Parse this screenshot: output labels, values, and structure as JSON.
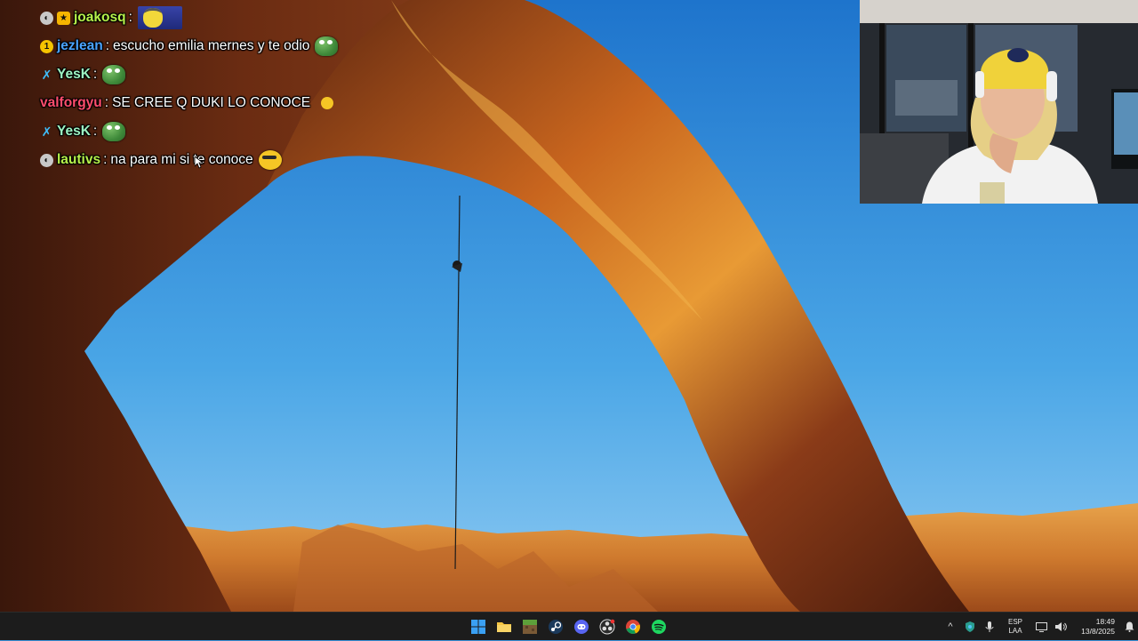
{
  "chat": {
    "messages": [
      {
        "user": "joakosq",
        "user_color": "#b6f04a",
        "text": "",
        "badges": [
          {
            "icon": "mod-shield-icon",
            "color": "#c8c8c8"
          },
          {
            "icon": "subscriber-badge-icon",
            "color": "#f5b400"
          }
        ],
        "emote": "minion-emote"
      },
      {
        "user": "jezlean",
        "user_color": "#4aa3ff",
        "text": "escucho emilia mernes y te odio",
        "badges": [
          {
            "icon": "bits-badge-icon",
            "color": "#f5c400"
          }
        ],
        "emote": "pepe-frog-emote"
      },
      {
        "user": "YesK",
        "user_color": "#9cf2c2",
        "text": "",
        "badges": [
          {
            "icon": "sword-badge-icon",
            "color": "#3fc0ff"
          }
        ],
        "emote": "pepe-frog-emote"
      },
      {
        "user": "valforgyu",
        "user_color": "#ff4d6d",
        "text": "SE CREE Q DUKI LO CONOCE",
        "badges": [],
        "emote": "small-yellow-emote"
      },
      {
        "user": "YesK",
        "user_color": "#9cf2c2",
        "text": "",
        "badges": [
          {
            "icon": "sword-badge-icon",
            "color": "#3fc0ff"
          }
        ],
        "emote": "pepe-frog-emote"
      },
      {
        "user": "lautivs",
        "user_color": "#b6f04a",
        "text": "na para mi si te conoce",
        "badges": [
          {
            "icon": "mod-shield-icon",
            "color": "#c8c8c8"
          }
        ],
        "emote": "smug-emote"
      }
    ]
  },
  "taskbar": {
    "apps": [
      {
        "name": "start-button",
        "icon": "windows-logo-icon"
      },
      {
        "name": "file-explorer-button",
        "icon": "folder-icon"
      },
      {
        "name": "minecraft-button",
        "icon": "grass-block-icon"
      },
      {
        "name": "steam-button",
        "icon": "steam-icon"
      },
      {
        "name": "discord-button",
        "icon": "discord-icon"
      },
      {
        "name": "obs-button",
        "icon": "obs-icon"
      },
      {
        "name": "chrome-button",
        "icon": "chrome-icon"
      },
      {
        "name": "spotify-button",
        "icon": "spotify-icon"
      }
    ],
    "tray": {
      "language_top": "ESP",
      "language_bottom": "LAA",
      "time": "18:49",
      "date": "13/8/2025"
    }
  },
  "colors": {
    "taskbar_bg": "#1c1c1c",
    "sky_top": "#2a7fd0",
    "rock": "#8a3e1c"
  }
}
